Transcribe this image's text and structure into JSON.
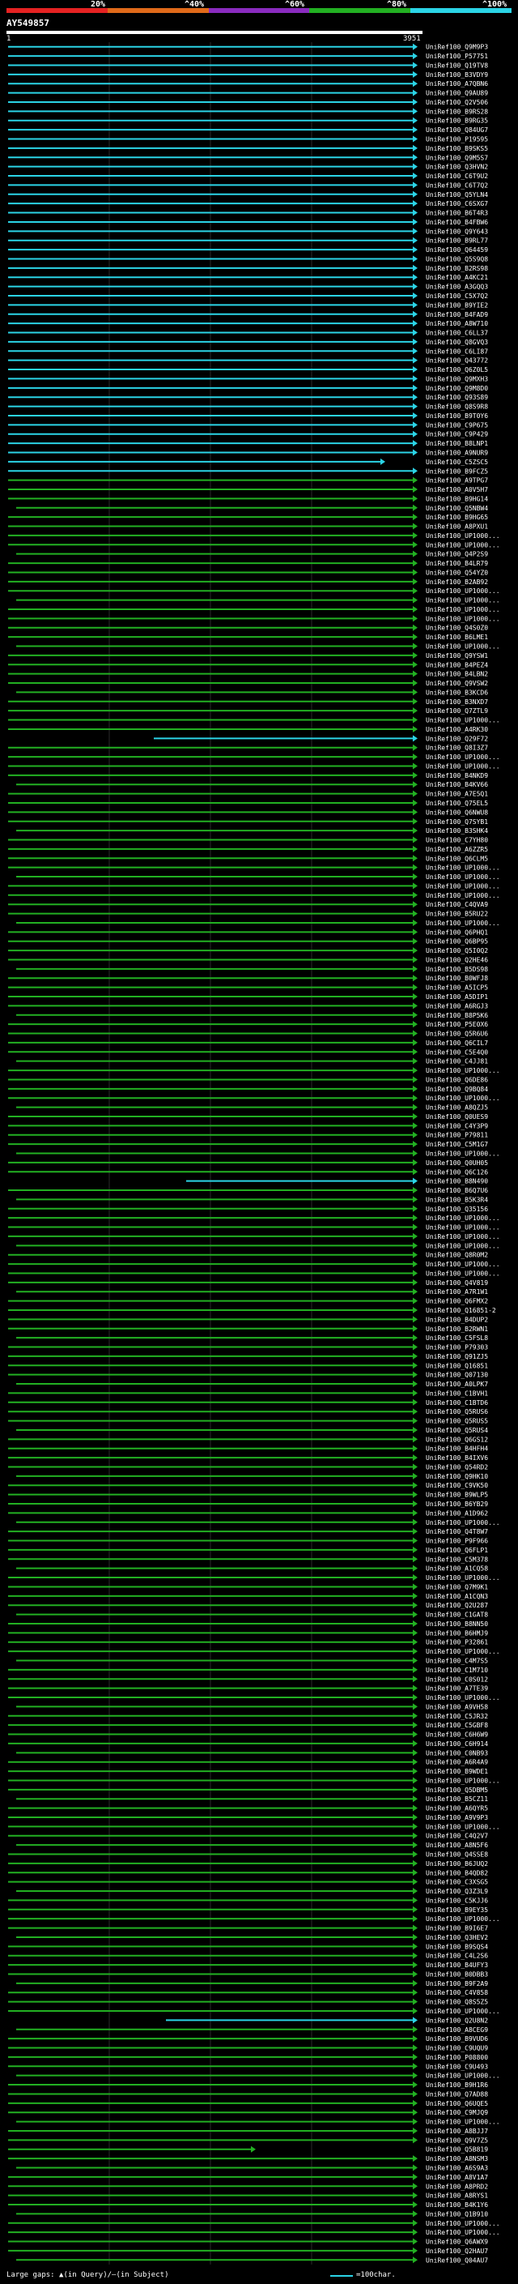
{
  "legend": {
    "colors": [
      "#e52222",
      "#e06a1a",
      "#8a2bbf",
      "#22b022",
      "#2bd4e6"
    ],
    "labels": [
      "20%",
      "^40%",
      "^60%",
      "^80%",
      "^100%"
    ]
  },
  "query": {
    "id": "AY549857",
    "start": "1",
    "end": "3951"
  },
  "footer": {
    "gaps_note": "Large gaps: ▲(in Query)/—(in Subject)",
    "scale_note": "=100char."
  },
  "hits": [
    "UniRef100_Q9M9P3",
    "UniRef100_P57751",
    "UniRef100_Q19TV8",
    "UniRef100_B3VDY9",
    "UniRef100_A7QBN6",
    "UniRef100_Q9AU89",
    "UniRef100_Q2V506",
    "UniRef100_B9RS28",
    "UniRef100_B9RG35",
    "UniRef100_Q84UG7",
    "UniRef100_P19595",
    "UniRef100_B9SKS5",
    "UniRef100_Q9M5S7",
    "UniRef100_Q3HVN2",
    "UniRef100_C6T9U2",
    "UniRef100_C6T7Q2",
    "UniRef100_Q5YLN4",
    "UniRef100_C6SXG7",
    "UniRef100_B6T4R3",
    "UniRef100_B4FBW6",
    "UniRef100_Q9Y643",
    "UniRef100_B9RL77",
    "UniRef100_Q64459",
    "UniRef100_Q5S9Q8",
    "UniRef100_B2RS98",
    "UniRef100_A4KC21",
    "UniRef100_A3GQQ3",
    "UniRef100_C5X7Q2",
    "UniRef100_B9YIE2",
    "UniRef100_B4FAD9",
    "UniRef100_A8W710",
    "UniRef100_C6LL37",
    "UniRef100_Q8GVQ3",
    "UniRef100_C6LI87",
    "UniRef100_Q43772",
    "UniRef100_Q6Z0L5",
    "UniRef100_Q9MXH3",
    "UniRef100_Q9M8D0",
    "UniRef100_Q93S89",
    "UniRef100_Q8S9R8",
    "UniRef100_B9T0Y6",
    "UniRef100_C9P675",
    "UniRef100_C9P429",
    "UniRef100_B8LNP1",
    "UniRef100_A9NUR9",
    "UniRef100_C5ZSC5",
    "UniRef100_B9FCZ5",
    "UniRef100_A9TPG7",
    "UniRef100_A0V5H7",
    "UniRef100_B9HG14",
    "UniRef100_Q5NBW4",
    "UniRef100_B9HG65",
    "UniRef100_A8PXU1",
    "UniRef100_UP1000...",
    "UniRef100_UP1000...",
    "UniRef100_Q4P2S9",
    "UniRef100_B4LR79",
    "UniRef100_Q54YZ0",
    "UniRef100_B2AB92",
    "UniRef100_UP1000...",
    "UniRef100_UP1000...",
    "UniRef100_UP1000...",
    "UniRef100_UP1000...",
    "UniRef100_Q4S0Z0",
    "UniRef100_B6LME1",
    "UniRef100_UP1000...",
    "UniRef100_Q9YSW1",
    "UniRef100_B4PEZ4",
    "UniRef100_B4LBN2",
    "UniRef100_Q9VSW2",
    "UniRef100_B3KCD6",
    "UniRef100_B3NXD7",
    "UniRef100_Q7ZTL9",
    "UniRef100_UP1000...",
    "UniRef100_A4RK30",
    "UniRef100_Q29F72",
    "UniRef100_Q8I3Z7",
    "UniRef100_UP1000...",
    "UniRef100_UP1000...",
    "UniRef100_B4NKD9",
    "UniRef100_B4KV66",
    "UniRef100_A7E5Q1",
    "UniRef100_Q75EL5",
    "UniRef100_Q6NWU8",
    "UniRef100_Q7SYB1",
    "UniRef100_B3SHK4",
    "UniRef100_C7YH80",
    "UniRef100_A6ZZR5",
    "UniRef100_Q6CLM5",
    "UniRef100_UP1000...",
    "UniRef100_UP1000...",
    "UniRef100_UP1000...",
    "UniRef100_UP1000...",
    "UniRef100_C4QVA9",
    "UniRef100_B5RU22",
    "UniRef100_UP1000...",
    "UniRef100_Q6PHQ1",
    "UniRef100_Q6BP95",
    "UniRef100_Q5I0Q2",
    "UniRef100_Q2HE46",
    "UniRef100_B5DS98",
    "UniRef100_B0WFJ8",
    "UniRef100_A5ICP5",
    "UniRef100_A5DIP1",
    "UniRef100_A6RGJ3",
    "UniRef100_B8P5K6",
    "UniRef100_P5E0X6",
    "UniRef100_Q5R6U6",
    "UniRef100_Q6CIL7",
    "UniRef100_C5E4Q0",
    "UniRef100_C4JJ81",
    "UniRef100_UP1000...",
    "UniRef100_Q6DE86",
    "UniRef100_Q9BQ84",
    "UniRef100_UP1000...",
    "UniRef100_A8QZJ5",
    "UniRef100_Q0UES9",
    "UniRef100_C4Y3P9",
    "UniRef100_P79811",
    "UniRef100_C5M1G7",
    "UniRef100_UP1000...",
    "UniRef100_Q0UH05",
    "UniRef100_Q6C126",
    "UniRef100_B8N490",
    "UniRef100_B6Q7U6",
    "UniRef100_B5K3R4",
    "UniRef100_Q35156",
    "UniRef100_UP1000...",
    "UniRef100_UP1000...",
    "UniRef100_UP1000...",
    "UniRef100_UP1000...",
    "UniRef100_Q8R0M2",
    "UniRef100_UP1000...",
    "UniRef100_UP1000...",
    "UniRef100_Q4V819",
    "UniRef100_A7R1W1",
    "UniRef100_Q6FMX2",
    "UniRef100_Q16851-2",
    "UniRef100_B4DUP2",
    "UniRef100_B2RWN1",
    "UniRef100_C5FSL8",
    "UniRef100_P79303",
    "UniRef100_Q91ZJ5",
    "UniRef100_Q16851",
    "UniRef100_Q07130",
    "UniRef100_A0LPK7",
    "UniRef100_C1BVH1",
    "UniRef100_C1BTD6",
    "UniRef100_Q5RUS6",
    "UniRef100_Q5RUS5",
    "UniRef100_Q5RUS4",
    "UniRef100_Q6GS12",
    "UniRef100_B4HFH4",
    "UniRef100_B4IXV6",
    "UniRef100_Q54RD2",
    "UniRef100_Q9HK10",
    "UniRef100_C9VK50",
    "UniRef100_B9WLP5",
    "UniRef100_B6YB29",
    "UniRef100_A1D962",
    "UniRef100_UP1000...",
    "UniRef100_Q4T8W7",
    "UniRef100_P9F966",
    "UniRef100_Q6FLP1",
    "UniRef100_C5M378",
    "UniRef100_A1CQ58",
    "UniRef100_UP1000...",
    "UniRef100_Q7M9K1",
    "UniRef100_A1CQN3",
    "UniRef100_Q2U287",
    "UniRef100_C1GAT8",
    "UniRef100_B8NN50",
    "UniRef100_B6HMJ9",
    "UniRef100_P32861",
    "UniRef100_UP1000...",
    "UniRef100_C4M7S5",
    "UniRef100_C1M710",
    "UniRef100_C0S012",
    "UniRef100_A7TE39",
    "UniRef100_UP1000...",
    "UniRef100_A9VH58",
    "UniRef100_C5JR32",
    "UniRef100_C5GBF8",
    "UniRef100_C6H6W9",
    "UniRef100_C6H914",
    "UniRef100_C0NB93",
    "UniRef100_A6R4A9",
    "UniRef100_B9WDE1",
    "UniRef100_UP1000...",
    "UniRef100_Q5DBM5",
    "UniRef100_B5CZ11",
    "UniRef100_A6QYR5",
    "UniRef100_A9V9P3",
    "UniRef100_UP1000...",
    "UniRef100_C4Q2V7",
    "UniRef100_A8N5F6",
    "UniRef100_Q4SSE8",
    "UniRef100_B6JUQ2",
    "UniRef100_B4QD82",
    "UniRef100_C3XSG5",
    "UniRef100_Q3Z3L9",
    "UniRef100_C5KJJ6",
    "UniRef100_B9EY35",
    "UniRef100_UP1000...",
    "UniRef100_B9I6E7",
    "UniRef100_Q3HEV2",
    "UniRef100_B9SQS4",
    "UniRef100_C4L2S6",
    "UniRef100_B4UFY3",
    "UniRef100_B0DBB3",
    "UniRef100_B9F2A9",
    "UniRef100_C4V858",
    "UniRef100_Q8S5Z5",
    "UniRef100_UP1000...",
    "UniRef100_Q2U8N2",
    "UniRef100_A8CEG9",
    "UniRef100_B9VUD6",
    "UniRef100_C9UQU9",
    "UniRef100_P08800",
    "UniRef100_C9U493",
    "UniRef100_UP1000...",
    "UniRef100_B9H1R6",
    "UniRef100_Q7AD88",
    "UniRef100_Q6UQE5",
    "UniRef100_C9MJQ9",
    "UniRef100_UP1000...",
    "UniRef100_A8BJJ7",
    "UniRef100_Q9V7Z5",
    "UniRef100_Q5B819",
    "UniRef100_A8NSM3",
    "UniRef100_A6S9A3",
    "UniRef100_A8V1A7",
    "UniRef100_A8PRD2",
    "UniRef100_A8RYS1",
    "UniRef100_B4K1Y6",
    "UniRef100_Q1B910",
    "UniRef100_UP1000...",
    "UniRef100_UP1000...",
    "UniRef100_Q6AWX9",
    "UniRef100_Q2HAU7",
    "UniRef100_Q04AU7"
  ]
}
